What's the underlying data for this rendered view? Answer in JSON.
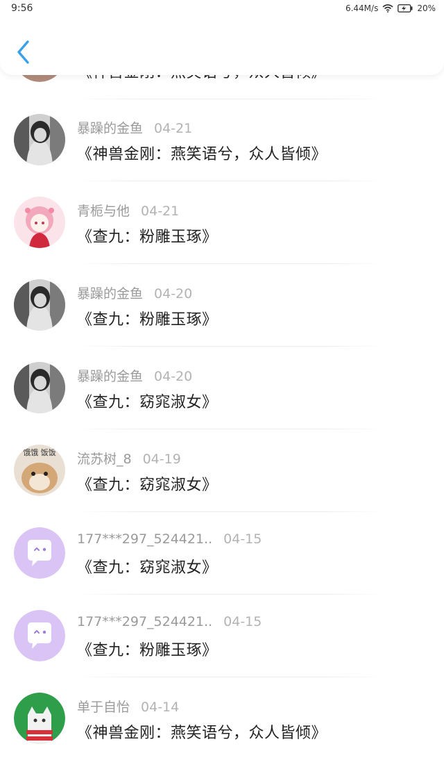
{
  "status_bar": {
    "time": "9:56",
    "net_speed": "6.44M/s",
    "battery": "20%"
  },
  "header": {
    "back_icon": "chevron-left-icon",
    "accent": "#3aa0e8"
  },
  "partial_item": {
    "title": "《神兽金刚：燕笑语兮，众人皆倾》"
  },
  "items": [
    {
      "name": "暴躁的金鱼",
      "date": "04-21",
      "title": "《神兽金刚：燕笑语兮，众人皆倾》",
      "avatar": "girl-photo-avatar"
    },
    {
      "name": "青栀与他",
      "date": "04-21",
      "title": "《查九：粉雕玉琢》",
      "avatar": "anime-girl-avatar"
    },
    {
      "name": "暴躁的金鱼",
      "date": "04-20",
      "title": "《查九：粉雕玉琢》",
      "avatar": "girl-photo-avatar"
    },
    {
      "name": "暴躁的金鱼",
      "date": "04-20",
      "title": "《查九：窈窕淑女》",
      "avatar": "girl-photo-avatar"
    },
    {
      "name": "流苏树_8",
      "date": "04-19",
      "title": "《查九：窈窕淑女》",
      "avatar": "hamster-avatar",
      "avatar_text": "饿饿 饭饭"
    },
    {
      "name": "177***297_524421..",
      "date": "04-15",
      "title": "《查九：窈窕淑女》",
      "avatar": "chat-bubble-avatar"
    },
    {
      "name": "177***297_524421..",
      "date": "04-15",
      "title": "《查九：粉雕玉琢》",
      "avatar": "chat-bubble-avatar"
    },
    {
      "name": "单于自怡",
      "date": "04-14",
      "title": "《神兽金刚：燕笑语兮，众人皆倾》",
      "avatar": "cat-avatar"
    }
  ]
}
